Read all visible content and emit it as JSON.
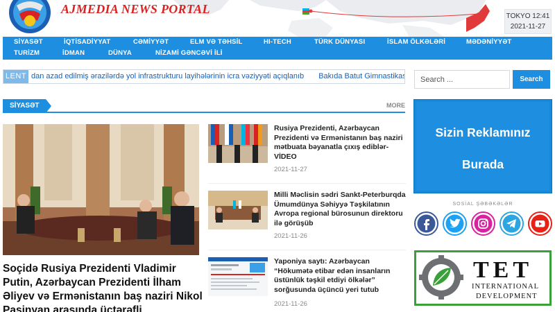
{
  "site": {
    "brand": "AJMEDIA NEWS PORTAL",
    "clock_city": "TOKYO 12:41",
    "clock_date": "2021-11-27"
  },
  "nav": {
    "row1": [
      "SİYASƏT",
      "İQTİSADİYYAT",
      "CƏMİYYƏT",
      "ELM VƏ TƏHSİL",
      "HI-TECH",
      "TÜRK DÜNYASI",
      "İSLAM ÖLKƏLƏRİ",
      "MƏDƏNİYYƏT"
    ],
    "row2": [
      "TURİZM",
      "İDMAN",
      "DÜNYA",
      "NİZAMİ GƏNCƏVİ İLİ"
    ]
  },
  "ticker": {
    "label": "LENT",
    "items": [
      "dan azad edilmiş ərazilərdə yol infrastrukturu layihələrinin icra vəziyyəti açıqlanıb",
      "Bakıda Batut Gimnastikası üzrə"
    ]
  },
  "search": {
    "placeholder": "Search ...",
    "button": "Search"
  },
  "section": {
    "title": "SİYASƏT",
    "more": "MORE"
  },
  "featured": {
    "title": "Soçidə Rusiya Prezidenti Vladimir Putin, Azərbaycan Prezidenti İlham Əliyev və Ermənistanın baş naziri Nikol Paşinyan arasında üçtərəfli"
  },
  "news": [
    {
      "title": "Rusiya Prezidenti, Azərbaycan Prezidenti və Ermənistanın baş naziri mətbuata bəyanatla çıxış ediblər-VİDEO",
      "date": "2021-11-27"
    },
    {
      "title": "Milli Məclisin sədri Sankt-Peterburqda Ümumdünya Səhiyyə Təşkilatının Avropa regional bürosunun direktoru ilə görüşüb",
      "date": "2021-11-26"
    },
    {
      "title": "Yaponiya saytı: Azərbaycan “Hökumətə etibar edən insanların üstünlük təşkil etdiyi ölkələr” sorğusunda üçüncü yeri tutub",
      "date": "2021-11-26"
    }
  ],
  "ad": {
    "line1": "Sizin Reklamınız",
    "line2": "Burada"
  },
  "social": {
    "label": "SOSİAL ŞƏBƏKƏLƏR",
    "icons": [
      "facebook-icon",
      "twitter-icon",
      "instagram-icon",
      "telegram-icon",
      "youtube-icon"
    ],
    "colors": [
      "#3b5998",
      "#1da1f2",
      "#d6249f",
      "#2ca5e0",
      "#e62117"
    ]
  },
  "partner": {
    "letters": "TET",
    "line1": "INTERNATIONAL",
    "line2": "DEVELOPMENT"
  },
  "colors": {
    "accent": "#1e8ee0",
    "brand_red": "#d92323",
    "partner_green": "#3aa13a"
  }
}
